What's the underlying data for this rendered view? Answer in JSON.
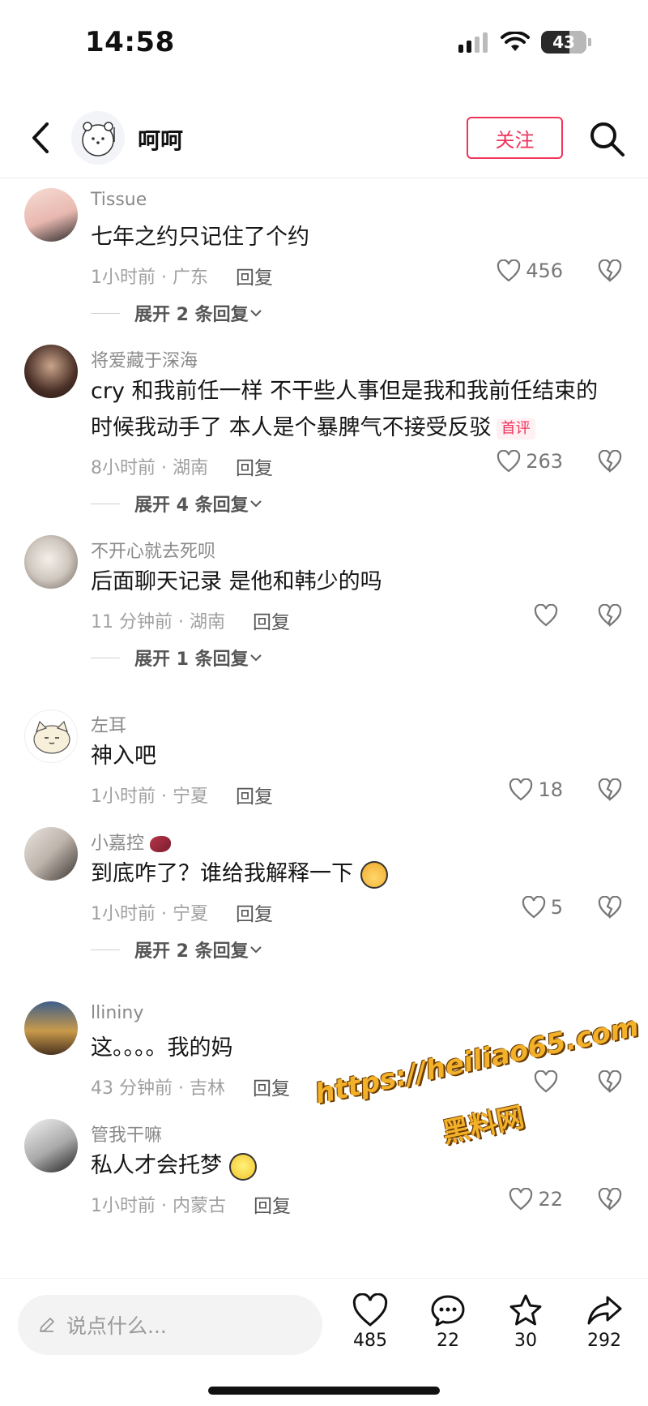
{
  "status": {
    "time": "14:58",
    "battery": "43"
  },
  "header": {
    "username": "呵呵",
    "follow_label": "关注"
  },
  "comments": [
    {
      "username": "Tissue",
      "text": "七年之约只记住了个约",
      "badge": "",
      "time": "1小时前 · 广东",
      "reply": "回复",
      "likes": "456",
      "expand": "展开 2 条回复"
    },
    {
      "username": "将爱藏于深海",
      "text": "cry 和我前任一样 不干些人事但是我和我前任结束的时候我动手了 本人是个暴脾气不接受反驳",
      "badge": "首评",
      "time": "8小时前 · 湖南",
      "reply": "回复",
      "likes": "263",
      "expand": "展开 4 条回复"
    },
    {
      "username": "不开心就去死呗",
      "text": "后面聊天记录 是他和韩少的吗",
      "badge": "",
      "time": "11 分钟前 · 湖南",
      "reply": "回复",
      "likes": "",
      "expand": "展开 1 条回复"
    },
    {
      "username": "左耳",
      "text": "神入吧",
      "badge": "",
      "time": "1小时前 · 宁夏",
      "reply": "回复",
      "likes": "18",
      "expand": ""
    },
    {
      "username": "小嘉控",
      "text": "到底咋了？谁给我解释一下",
      "badge": "",
      "time": "1小时前 · 宁夏",
      "reply": "回复",
      "likes": "5",
      "expand": "展开 2 条回复"
    },
    {
      "username": "llininy",
      "text": "这。。。。我的妈",
      "badge": "",
      "time": "43 分钟前 · 吉林",
      "reply": "回复",
      "likes": "",
      "expand": ""
    },
    {
      "username": "管我干嘛",
      "text": "私人才会托梦",
      "badge": "",
      "time": "1小时前 · 内蒙古",
      "reply": "回复",
      "likes": "22",
      "expand": ""
    }
  ],
  "watermark": {
    "url": "https://heiliao65.com",
    "name": "黑料网"
  },
  "bottom": {
    "input_placeholder": "说点什么...",
    "like_count": "485",
    "comment_count": "22",
    "favorite_count": "30",
    "share_count": "292"
  },
  "icons": [
    "back-icon",
    "search-icon",
    "heart-icon",
    "broken-heart-icon",
    "chevron-down-icon",
    "pencil-icon",
    "comment-icon",
    "star-icon",
    "share-icon",
    "signal-icon",
    "wifi-icon",
    "battery-icon"
  ],
  "colors": {
    "accent": "#f0335a",
    "meta_gray": "#a0a0a0",
    "watermark": "#f3b12a"
  }
}
